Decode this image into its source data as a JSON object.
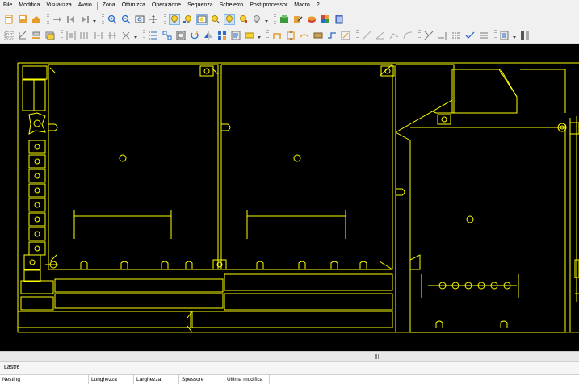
{
  "menu": {
    "items": [
      "File",
      "Modifica",
      "Visualizza",
      "Avvio",
      "Zona",
      "Ottimizza",
      "Operazione",
      "Sequenza",
      "Scheletro",
      "Post-processor",
      "Macro",
      "?"
    ]
  },
  "panel": {
    "tab_label": "Lastre"
  },
  "table": {
    "columns": [
      "Nesting",
      "Lunghezza",
      "Larghezza",
      "Spessore",
      "Ultima modifica"
    ]
  },
  "colors": {
    "canvas_bg": "#000000",
    "geometry": "#ffff00",
    "toolbar_bg": "#f0f0f0"
  }
}
